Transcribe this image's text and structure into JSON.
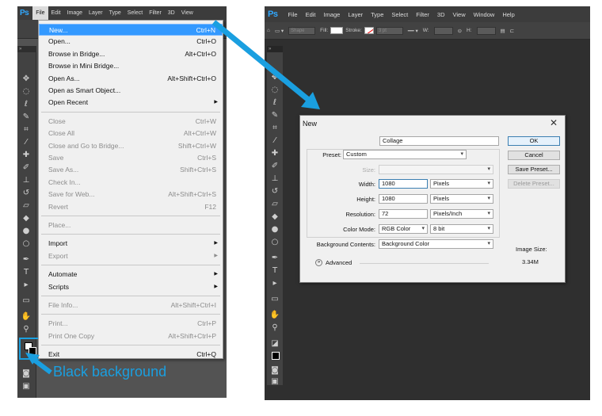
{
  "app": {
    "logo": "Ps",
    "menus": [
      "File",
      "Edit",
      "Image",
      "Layer",
      "Type",
      "Select",
      "Filter",
      "3D",
      "View",
      "Window",
      "Help"
    ],
    "active_menu": "File"
  },
  "left_menu": {
    "items": [
      {
        "label": "New...",
        "shortcut": "Ctrl+N",
        "state": "highlight"
      },
      {
        "label": "Open...",
        "shortcut": "Ctrl+O",
        "state": "enabled"
      },
      {
        "label": "Browse in Bridge...",
        "shortcut": "Alt+Ctrl+O",
        "state": "enabled"
      },
      {
        "label": "Browse in Mini Bridge...",
        "shortcut": "",
        "state": "enabled"
      },
      {
        "label": "Open As...",
        "shortcut": "Alt+Shift+Ctrl+O",
        "state": "enabled"
      },
      {
        "label": "Open as Smart Object...",
        "shortcut": "",
        "state": "enabled"
      },
      {
        "label": "Open Recent",
        "shortcut": "",
        "state": "enabled",
        "submenu": true
      },
      {
        "label": "Close",
        "shortcut": "Ctrl+W",
        "state": "disabled"
      },
      {
        "label": "Close All",
        "shortcut": "Alt+Ctrl+W",
        "state": "disabled"
      },
      {
        "label": "Close and Go to Bridge...",
        "shortcut": "Shift+Ctrl+W",
        "state": "disabled"
      },
      {
        "label": "Save",
        "shortcut": "Ctrl+S",
        "state": "disabled"
      },
      {
        "label": "Save As...",
        "shortcut": "Shift+Ctrl+S",
        "state": "disabled"
      },
      {
        "label": "Check In...",
        "shortcut": "",
        "state": "disabled"
      },
      {
        "label": "Save for Web...",
        "shortcut": "Alt+Shift+Ctrl+S",
        "state": "disabled"
      },
      {
        "label": "Revert",
        "shortcut": "F12",
        "state": "disabled"
      },
      {
        "label": "Place...",
        "shortcut": "",
        "state": "disabled"
      },
      {
        "label": "Import",
        "shortcut": "",
        "state": "enabled",
        "submenu": true
      },
      {
        "label": "Export",
        "shortcut": "",
        "state": "disabled",
        "submenu": true
      },
      {
        "label": "Automate",
        "shortcut": "",
        "state": "enabled",
        "submenu": true
      },
      {
        "label": "Scripts",
        "shortcut": "",
        "state": "enabled",
        "submenu": true
      },
      {
        "label": "File Info...",
        "shortcut": "Alt+Shift+Ctrl+I",
        "state": "disabled"
      },
      {
        "label": "Print...",
        "shortcut": "Ctrl+P",
        "state": "disabled"
      },
      {
        "label": "Print One Copy",
        "shortcut": "Alt+Shift+Ctrl+P",
        "state": "disabled"
      },
      {
        "label": "Exit",
        "shortcut": "Ctrl+Q",
        "state": "enabled"
      }
    ]
  },
  "options_bar": {
    "shape_label": "Shape",
    "fill_label": "Fill:",
    "stroke_label": "Stroke:",
    "stroke_width": "3 pt",
    "w_label": "W:",
    "h_label": "H:"
  },
  "annotation": {
    "label": "Black background"
  },
  "dialog": {
    "title": "New",
    "close_glyph": "✕",
    "name_label": "Name:",
    "name_value": "Collage",
    "preset_label": "Preset:",
    "preset_value": "Custom",
    "size_label": "Size:",
    "width_label": "Width:",
    "width_value": "1080",
    "width_unit": "Pixels",
    "height_label": "Height:",
    "height_value": "1080",
    "height_unit": "Pixels",
    "resolution_label": "Resolution:",
    "resolution_value": "72",
    "resolution_unit": "Pixels/Inch",
    "color_mode_label": "Color Mode:",
    "color_mode_value": "RGB Color",
    "bit_depth_value": "8 bit",
    "bg_contents_label": "Background Contents:",
    "bg_contents_value": "Background Color",
    "advanced_label": "Advanced",
    "ok_label": "OK",
    "cancel_label": "Cancel",
    "save_preset_label": "Save Preset...",
    "delete_preset_label": "Delete Preset...",
    "image_size_label": "Image Size:",
    "image_size_value": "3.34M"
  },
  "colors": {
    "accent_blue": "#1a9fe0",
    "menu_highlight": "#3399ff",
    "ps_dark": "#535353"
  }
}
